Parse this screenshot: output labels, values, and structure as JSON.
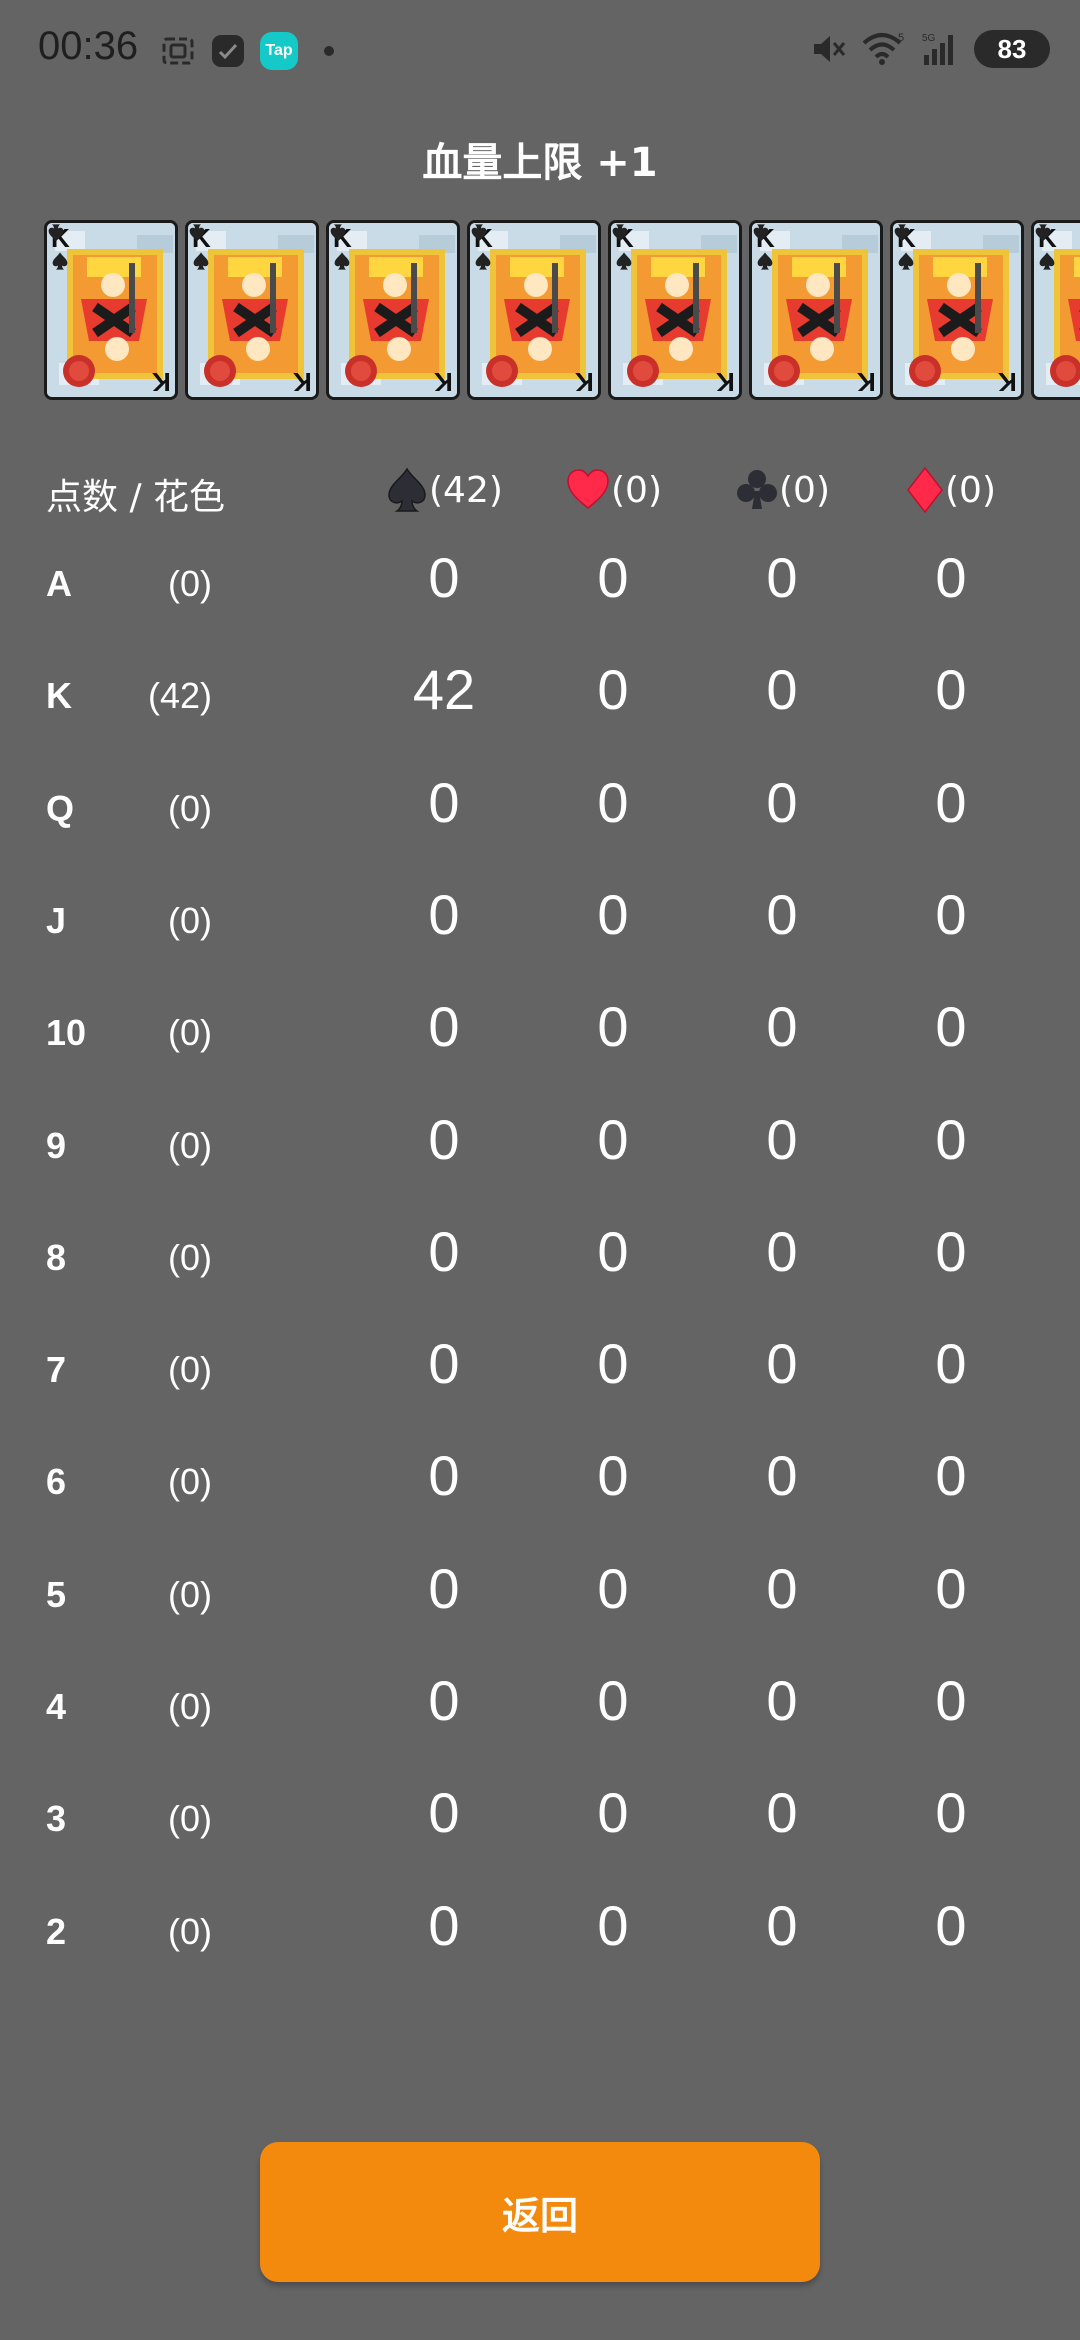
{
  "status_bar": {
    "time": "00:36",
    "battery": "83",
    "tap_label": "Tap",
    "icons": [
      "screenshot-icon",
      "app-icon",
      "tap-app-icon",
      "notification-dot-icon",
      "mute-icon",
      "wifi-icon",
      "signal-5g-icon",
      "battery-icon"
    ]
  },
  "title": "血量上限 +1",
  "cards": {
    "count_visible": 7,
    "rank": "K",
    "suit": "spade",
    "color_face": "#c9dbe6"
  },
  "table": {
    "header_label": "点数 / 花色",
    "suits": [
      {
        "name": "spade",
        "count": "(42)",
        "color": "#2d2d35"
      },
      {
        "name": "heart",
        "count": "(0)",
        "color": "#ff2a4a"
      },
      {
        "name": "club",
        "count": "(0)",
        "color": "#2d2d35"
      },
      {
        "name": "diamond",
        "count": "(0)",
        "color": "#ff2a4a"
      }
    ],
    "rows": [
      {
        "rank": "A",
        "count": "(0)",
        "values": [
          "0",
          "0",
          "0",
          "0"
        ]
      },
      {
        "rank": "K",
        "count": "(42)",
        "values": [
          "42",
          "0",
          "0",
          "0"
        ]
      },
      {
        "rank": "Q",
        "count": "(0)",
        "values": [
          "0",
          "0",
          "0",
          "0"
        ]
      },
      {
        "rank": "J",
        "count": "(0)",
        "values": [
          "0",
          "0",
          "0",
          "0"
        ]
      },
      {
        "rank": "10",
        "count": "(0)",
        "values": [
          "0",
          "0",
          "0",
          "0"
        ]
      },
      {
        "rank": "9",
        "count": "(0)",
        "values": [
          "0",
          "0",
          "0",
          "0"
        ]
      },
      {
        "rank": "8",
        "count": "(0)",
        "values": [
          "0",
          "0",
          "0",
          "0"
        ]
      },
      {
        "rank": "7",
        "count": "(0)",
        "values": [
          "0",
          "0",
          "0",
          "0"
        ]
      },
      {
        "rank": "6",
        "count": "(0)",
        "values": [
          "0",
          "0",
          "0",
          "0"
        ]
      },
      {
        "rank": "5",
        "count": "(0)",
        "values": [
          "0",
          "0",
          "0",
          "0"
        ]
      },
      {
        "rank": "4",
        "count": "(0)",
        "values": [
          "0",
          "0",
          "0",
          "0"
        ]
      },
      {
        "rank": "3",
        "count": "(0)",
        "values": [
          "0",
          "0",
          "0",
          "0"
        ]
      },
      {
        "rank": "2",
        "count": "(0)",
        "values": [
          "0",
          "0",
          "0",
          "0"
        ]
      }
    ]
  },
  "return_button_label": "返回",
  "colors": {
    "background": "#646464",
    "button": "#f38a0e"
  }
}
